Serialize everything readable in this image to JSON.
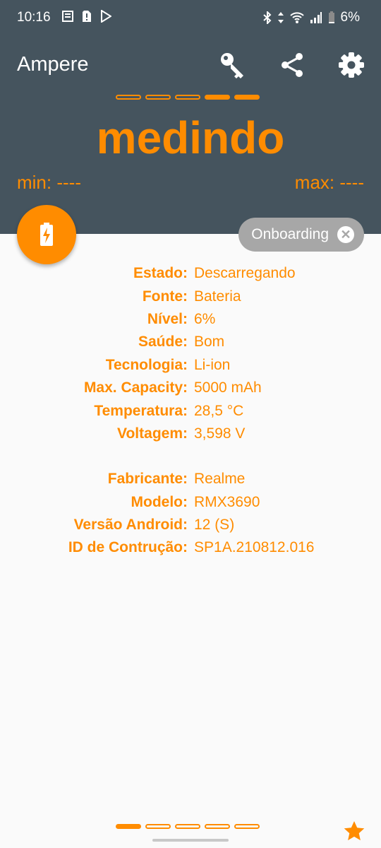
{
  "status_bar": {
    "time": "10:16",
    "battery_percent": "6%",
    "left_icons": [
      "news-icon",
      "sim-alert-icon",
      "play-store-icon"
    ],
    "right_icons": [
      "bluetooth-icon",
      "data-arrows-icon",
      "wifi-icon",
      "signal-icon",
      "battery-icon"
    ]
  },
  "header": {
    "title": "Ampere",
    "actions": [
      "key-icon",
      "share-icon",
      "settings-icon"
    ],
    "page_indicator_active": [
      4,
      5
    ],
    "page_indicator_count": 5,
    "status": "medindo",
    "min_label": "min: ----",
    "max_label": "max: ----"
  },
  "chip": {
    "label": "Onboarding"
  },
  "battery_info": [
    {
      "label": "Estado:",
      "value": "Descarregando"
    },
    {
      "label": "Fonte:",
      "value": "Bateria"
    },
    {
      "label": "Nível:",
      "value": "6%"
    },
    {
      "label": "Saúde:",
      "value": "Bom"
    },
    {
      "label": "Tecnologia:",
      "value": "Li-ion"
    },
    {
      "label": "Max. Capacity:",
      "value": "5000 mAh"
    },
    {
      "label": "Temperatura:",
      "value": "28,5 °C"
    },
    {
      "label": "Voltagem:",
      "value": "3,598 V"
    }
  ],
  "device_info": [
    {
      "label": "Fabricante:",
      "value": "Realme"
    },
    {
      "label": "Modelo:",
      "value": "RMX3690"
    },
    {
      "label": "Versão Android:",
      "value": "12 (S)"
    },
    {
      "label": "ID de Contrução:",
      "value": "SP1A.210812.016"
    }
  ],
  "bottom_indicator_active": 1,
  "colors": {
    "accent": "#ff8c00",
    "header_bg": "#45545e",
    "chip_bg": "#a7a7a7"
  }
}
